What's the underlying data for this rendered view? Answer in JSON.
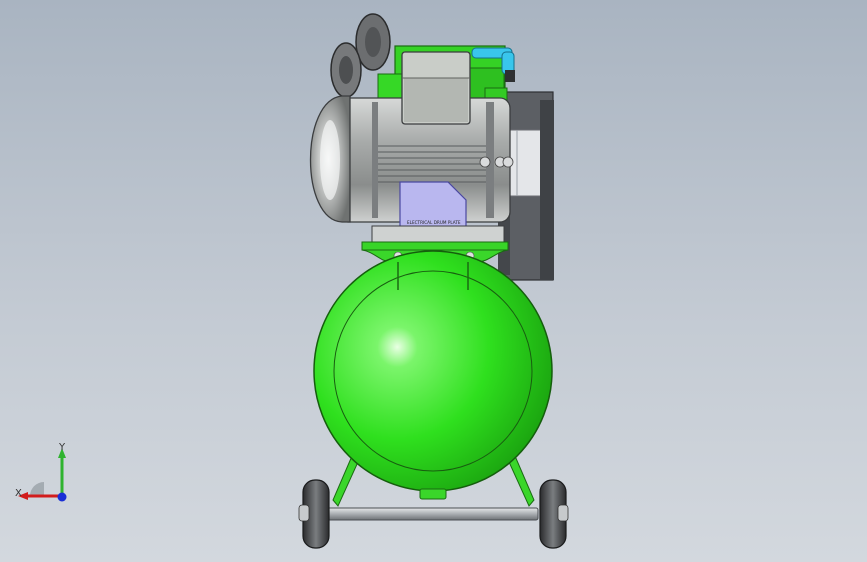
{
  "viewport": {
    "background_top": "#a9b4c1",
    "background_bottom": "#d3d8de"
  },
  "model": {
    "nameplate_text": "ELECTRICAL DRUM PLATE",
    "colors": {
      "tank": "#2fe01e",
      "frame": "#3ad62a",
      "motor_body": "#a9acab",
      "terminal_box": "#c9cdc8",
      "nameplate": "#b9b7ef",
      "pipe": "#39c6ec",
      "shroud": "#5a5d62"
    }
  },
  "triad": {
    "x_label": "X",
    "y_label": "Y",
    "x_color": "#d21c1c",
    "y_color": "#2fb32f",
    "z_color": "#1a2fd6"
  }
}
